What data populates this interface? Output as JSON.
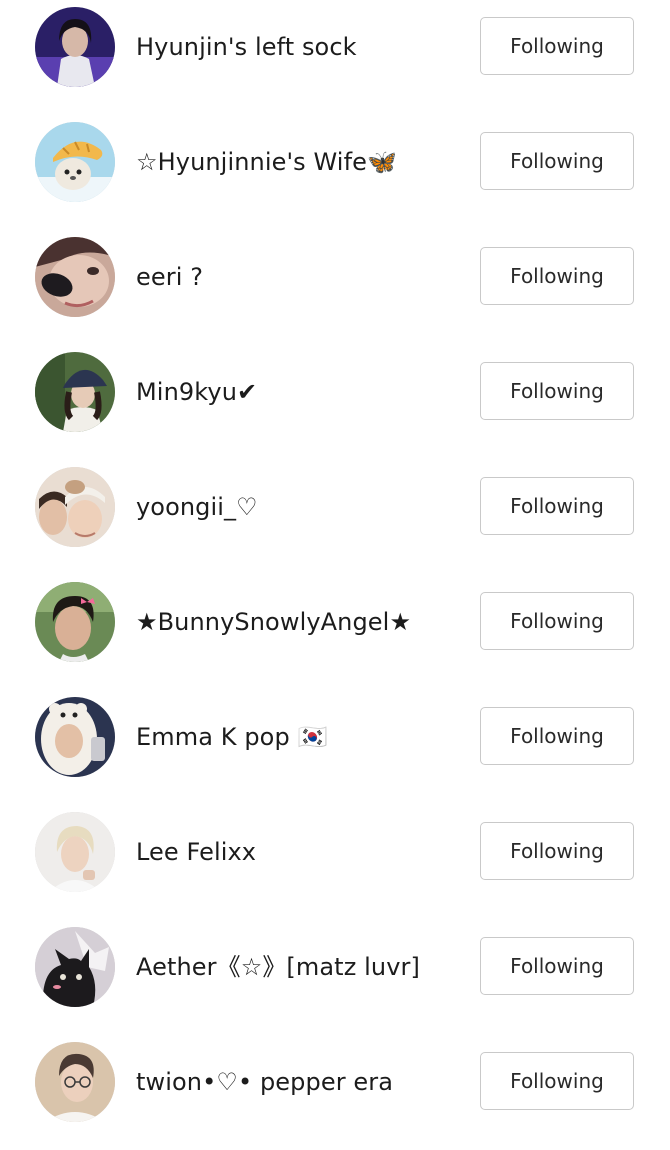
{
  "following_list": [
    {
      "name": "Hyunjin's left sock",
      "button_label": "Following",
      "avatar_icon": "avatar-dark-portrait",
      "avatar_color": "#3b2a7a"
    },
    {
      "name": "☆Hyunjinnie's Wife🦋",
      "button_label": "Following",
      "avatar_icon": "avatar-seal-with-fish-hat",
      "avatar_color": "#9fd3e8"
    },
    {
      "name": "eeri ?",
      "button_label": "Following",
      "avatar_icon": "avatar-face-sunglasses",
      "avatar_color": "#c8a497"
    },
    {
      "name": "Min9kyu✔",
      "button_label": "Following",
      "avatar_icon": "avatar-person-bucket-hat",
      "avatar_color": "#5a6b4a"
    },
    {
      "name": "yoongii_♡",
      "button_label": "Following",
      "avatar_icon": "avatar-two-people-selfie",
      "avatar_color": "#e7d6c6"
    },
    {
      "name": "★BunnySnowlyAngel★",
      "button_label": "Following",
      "avatar_icon": "avatar-person-pink-bow",
      "avatar_color": "#5f7e4e"
    },
    {
      "name": "Emma K pop 🇰🇷",
      "button_label": "Following",
      "avatar_icon": "avatar-person-costume-selfie",
      "avatar_color": "#2d3550"
    },
    {
      "name": "Lee Felixx",
      "button_label": "Following",
      "avatar_icon": "avatar-blond-person",
      "avatar_color": "#ece9e6"
    },
    {
      "name": "Aether《☆》[matz luvr]",
      "button_label": "Following",
      "avatar_icon": "avatar-black-cat-drawing",
      "avatar_color": "#c9c3cc"
    },
    {
      "name": "twion•♡• pepper era",
      "button_label": "Following",
      "avatar_icon": "avatar-person-glasses",
      "avatar_color": "#d7c0a6"
    }
  ]
}
